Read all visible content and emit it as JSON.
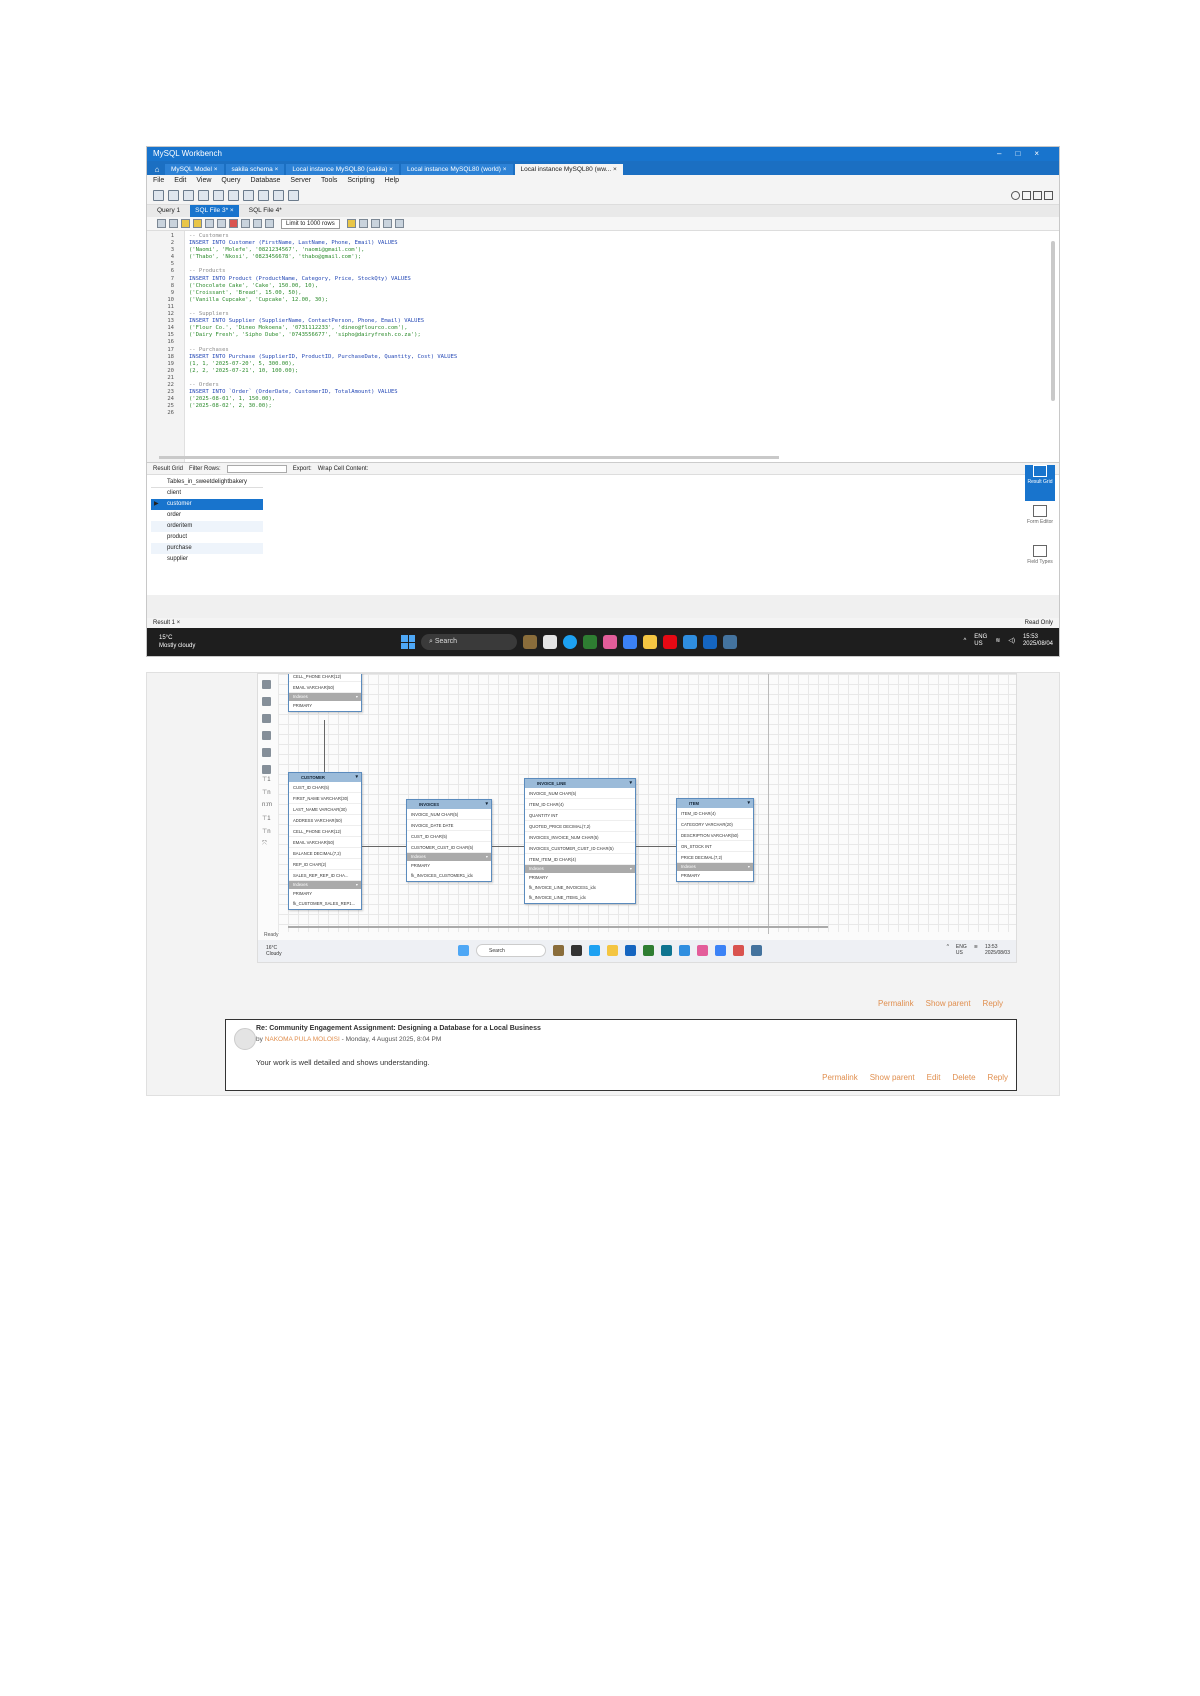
{
  "workbench": {
    "title": "MySQL Workbench",
    "window_controls": [
      "–",
      "□",
      "×"
    ],
    "tabs": [
      {
        "label": "MySQL Model ×"
      },
      {
        "label": "sakila schema ×"
      },
      {
        "label": "Local instance MySQL80 (sakila) ×"
      },
      {
        "label": "Local instance MySQL80 (world) ×"
      },
      {
        "label": "Local instance MySQL80 (ww... ×",
        "active": true
      }
    ],
    "menu": [
      "File",
      "Edit",
      "View",
      "Query",
      "Database",
      "Server",
      "Tools",
      "Scripting",
      "Help"
    ],
    "query_tabs": [
      "Query 1",
      "SQL File 3* ×",
      "SQL File 4*"
    ],
    "limit_label": "Limit to 1000 rows",
    "code_lines": [
      {
        "n": "1",
        "t": "-- Customers",
        "c": "comment"
      },
      {
        "n": "2",
        "t": "INSERT INTO Customer (FirstName, LastName, Phone, Email) VALUES",
        "c": "kw"
      },
      {
        "n": "3",
        "t": "('Naomi', 'Molefe', '0821234567', 'naomi@gmail.com'),",
        "c": "str"
      },
      {
        "n": "4",
        "t": "('Thabo', 'Nkosi', '0823456678', 'thabo@gmail.com');",
        "c": "str"
      },
      {
        "n": "5",
        "t": "",
        "c": ""
      },
      {
        "n": "6",
        "t": "-- Products",
        "c": "comment"
      },
      {
        "n": "7",
        "t": "INSERT INTO Product (ProductName, Category, Price, StockQty) VALUES",
        "c": "kw"
      },
      {
        "n": "8",
        "t": "('Chocolate Cake', 'Cake', 150.00, 10),",
        "c": "str"
      },
      {
        "n": "9",
        "t": "('Croissant', 'Bread', 15.00, 50),",
        "c": "str"
      },
      {
        "n": "10",
        "t": "('Vanilla Cupcake', 'Cupcake', 12.00, 30);",
        "c": "str"
      },
      {
        "n": "11",
        "t": "",
        "c": ""
      },
      {
        "n": "12",
        "t": "-- Suppliers",
        "c": "comment"
      },
      {
        "n": "13",
        "t": "INSERT INTO Supplier (SupplierName, ContactPerson, Phone, Email) VALUES",
        "c": "kw"
      },
      {
        "n": "14",
        "t": "('Flour Co.', 'Dineo Mokoena', '0731112233', 'dineo@flourco.com'),",
        "c": "str"
      },
      {
        "n": "15",
        "t": "('Dairy Fresh', 'Sipho Dube', '0743556677', 'sipho@dairyfresh.co.za');",
        "c": "str"
      },
      {
        "n": "16",
        "t": "",
        "c": ""
      },
      {
        "n": "17",
        "t": "-- Purchases",
        "c": "comment"
      },
      {
        "n": "18",
        "t": "INSERT INTO Purchase (SupplierID, ProductID, PurchaseDate, Quantity, Cost) VALUES",
        "c": "kw"
      },
      {
        "n": "19",
        "t": "(1, 1, '2025-07-20', 5, 300.00),",
        "c": "str"
      },
      {
        "n": "20",
        "t": "(2, 2, '2025-07-21', 10, 100.00);",
        "c": "str"
      },
      {
        "n": "21",
        "t": "",
        "c": ""
      },
      {
        "n": "22",
        "t": "-- Orders",
        "c": "comment"
      },
      {
        "n": "23",
        "t": "INSERT INTO `Order` (OrderDate, CustomerID, TotalAmount) VALUES",
        "c": "kw"
      },
      {
        "n": "24",
        "t": "('2025-08-01', 1, 150.00),",
        "c": "str"
      },
      {
        "n": "25",
        "t": "('2025-08-02', 2, 30.00);",
        "c": "str"
      },
      {
        "n": "26",
        "t": "",
        "c": ""
      }
    ],
    "result_bar": {
      "grid": "Result Grid",
      "filter": "Filter Rows:",
      "export": "Export:",
      "wrap": "Wrap Cell Content:"
    },
    "result_header": "Tables_in_sweetdelightbakery",
    "result_rows": [
      "client",
      "customer",
      "order",
      "orderitem",
      "product",
      "purchase",
      "supplier"
    ],
    "selected_row": 1,
    "side_panel": [
      "Result Grid",
      "Form Editor",
      "Field Types"
    ],
    "output_tab": "Result 1 ×",
    "read_only": "Read Only",
    "taskbar": {
      "temp": "15°C",
      "weather": "Mostly cloudy",
      "search": "Search",
      "lang": "ENG",
      "region": "US",
      "time": "15:53",
      "date": "2025/08/04"
    }
  },
  "er_diagram": {
    "tables": [
      {
        "name": "",
        "fields": [
          "CELL_PHONE CHAR(12)",
          "EMAIL VARCHAR(50)"
        ],
        "indexes": [
          "PRIMARY"
        ]
      },
      {
        "name": "CUSTOMER",
        "fields": [
          "CUST_ID CHAR(5)",
          "FIRST_NAME VARCHAR(30)",
          "LAST_NAME VARCHAR(30)",
          "ADDRESS VARCHAR(50)",
          "CELL_PHONE CHAR(12)",
          "EMAIL VARCHAR(50)",
          "BALANCE DECIMAL(7,2)",
          "REP_ID CHAR(2)",
          "SALES_REP_REP_ID CHA..."
        ],
        "indexes": [
          "PRIMARY",
          "fk_CUSTOMER_SALES_REP1..."
        ]
      },
      {
        "name": "INVOICES",
        "fields": [
          "INVOICE_NUM CHAR(5)",
          "INVOICE_DATE DATE",
          "CUST_ID CHAR(5)",
          "CUSTOMER_CUST_ID CHAR(5)"
        ],
        "indexes": [
          "PRIMARY",
          "fk_INVOICES_CUSTOMER1_idx"
        ]
      },
      {
        "name": "INVOICE_LINE",
        "fields": [
          "INVOICE_NUM CHAR(5)",
          "ITEM_ID CHAR(4)",
          "QUANTITY INT",
          "QUOTED_PRICE DECIMAL(7,2)",
          "INVOICES_INVOICE_NUM CHAR(5)",
          "INVOICES_CUSTOMER_CUST_ID CHAR(5)",
          "ITEM_ITEM_ID CHAR(4)"
        ],
        "indexes": [
          "PRIMARY",
          "fk_INVOICE_LINE_INVOICES1_idx",
          "fk_INVOICE_LINE_ITEM1_idx"
        ]
      },
      {
        "name": "ITEM",
        "fields": [
          "ITEM_ID CHAR(4)",
          "CATEGORY VARCHAR(20)",
          "DESCRIPTION VARCHAR(50)",
          "ON_STOCK INT",
          "PRICE DECIMAL(7,2)"
        ],
        "indexes": [
          "PRIMARY"
        ]
      }
    ],
    "section_label": "Indexes",
    "ready": "Ready",
    "taskbar": {
      "temp": "16°C",
      "weather": "Cloudy",
      "search": "Search",
      "lang": "ENG",
      "region": "US",
      "time": "13:53",
      "date": "2025/08/03"
    }
  },
  "post_links": [
    "Permalink",
    "Show parent",
    "Reply"
  ],
  "reply": {
    "subject": "Re: Community Engagement Assignment: Designing a Database for a Local Business",
    "by": "by",
    "author": "NAKOMA PULA MOLOISI",
    "date": " - Monday, 4 August 2025, 8:04 PM",
    "text": "Your work is well detailed and shows understanding.",
    "links": [
      "Permalink",
      "Show parent",
      "Edit",
      "Delete",
      "Reply"
    ]
  }
}
